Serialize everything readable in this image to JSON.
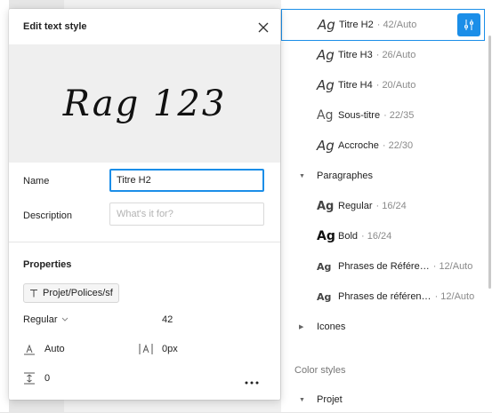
{
  "modal": {
    "title": "Edit text style",
    "preview_text": "Rag 123",
    "name_label": "Name",
    "name_value": "Titre H2",
    "description_label": "Description",
    "description_placeholder": "What's it for?",
    "properties_title": "Properties",
    "font_family": "Projet/Polices/sf",
    "font_weight": "Regular",
    "font_size": "42",
    "line_height": "Auto",
    "letter_spacing": "0px",
    "paragraph_spacing": "0"
  },
  "styles": {
    "items": [
      {
        "glyph": "Ag",
        "name": "Titre H2",
        "meta": "· 42/Auto"
      },
      {
        "glyph": "Ag",
        "name": "Titre H3",
        "meta": "· 26/Auto"
      },
      {
        "glyph": "Ag",
        "name": "Titre H4",
        "meta": "· 20/Auto"
      },
      {
        "glyph": "Ag",
        "name": "Sous-titre",
        "meta": "· 22/35"
      },
      {
        "glyph": "Ag",
        "name": "Accroche",
        "meta": "· 22/30"
      }
    ],
    "group_paragraphes": "Paragraphes",
    "para_items": [
      {
        "glyph": "Ag",
        "name": "Regular",
        "meta": "· 16/24"
      },
      {
        "glyph": "Ag",
        "name": "Bold",
        "meta": "· 16/24"
      },
      {
        "glyph": "Ag",
        "name": "Phrases de Référe…",
        "meta": "· 12/Auto"
      },
      {
        "glyph": "Ag",
        "name": "Phrases de référen…",
        "meta": "· 12/Auto"
      }
    ],
    "group_icones": "Icones",
    "color_styles_label": "Color styles",
    "group_projet": "Projet"
  },
  "colors": {
    "accent": "#1b8ee8"
  }
}
